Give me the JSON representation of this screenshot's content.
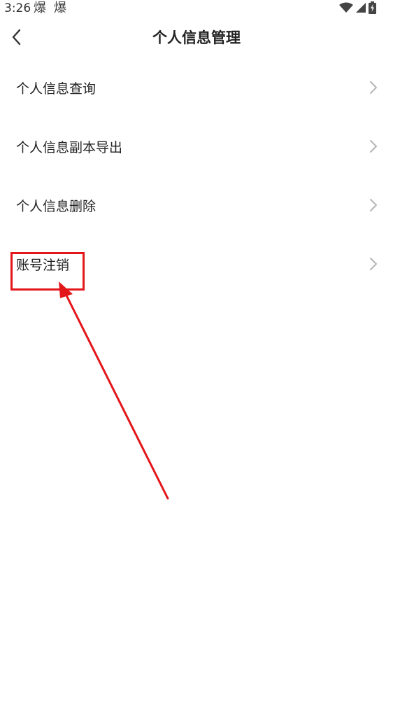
{
  "status_bar": {
    "time": "3:26",
    "notification_1": "爆",
    "notification_2": "爆",
    "icons": [
      "wifi-icon",
      "cell-signal-icon",
      "battery-charging-icon"
    ]
  },
  "nav": {
    "title": "个人信息管理",
    "back_icon": "chevron-left-icon"
  },
  "menu": {
    "items": [
      {
        "label": "个人信息查询"
      },
      {
        "label": "个人信息副本导出"
      },
      {
        "label": "个人信息删除"
      },
      {
        "label": "账号注销"
      }
    ]
  },
  "colors": {
    "annotation": "#e3161b",
    "chevron": "#b5b5b5",
    "text": "#222222"
  }
}
